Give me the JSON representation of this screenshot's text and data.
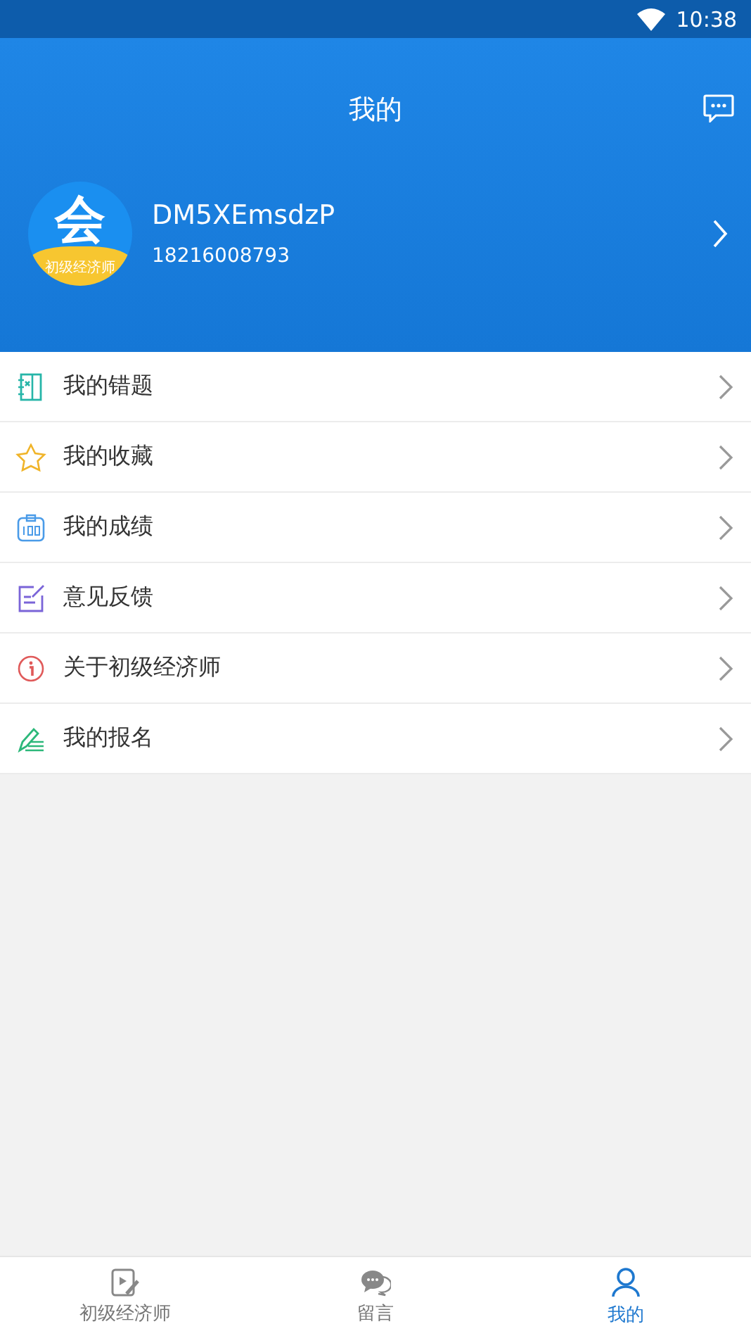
{
  "status_bar": {
    "time": "10:38"
  },
  "header": {
    "title": "我的"
  },
  "profile": {
    "avatar": {
      "glyph": "会",
      "caption": "初级经济师"
    },
    "name": "DM5XEmsdzP",
    "phone": "18216008793"
  },
  "menu": [
    {
      "kind": "errors",
      "label": "我的错题"
    },
    {
      "kind": "favorites",
      "label": "我的收藏"
    },
    {
      "kind": "scores",
      "label": "我的成绩"
    },
    {
      "kind": "feedback",
      "label": "意见反馈"
    },
    {
      "kind": "about",
      "label": "关于初级经济师"
    },
    {
      "kind": "signup",
      "label": "我的报名"
    }
  ],
  "bottom_nav": [
    {
      "kind": "exam",
      "label": "初级经济师",
      "selected": false
    },
    {
      "kind": "messages",
      "label": "留言",
      "selected": false
    },
    {
      "kind": "me",
      "label": "我的",
      "selected": true
    }
  ]
}
